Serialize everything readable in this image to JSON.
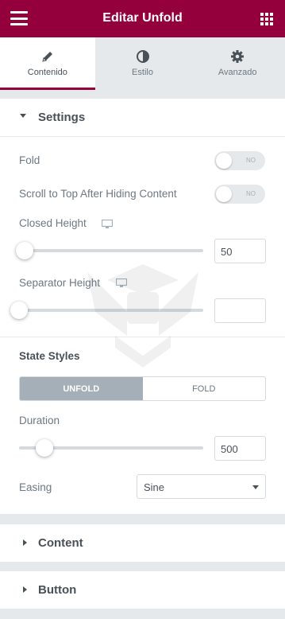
{
  "header": {
    "title": "Editar Unfold"
  },
  "tabs": [
    {
      "label": "Contenido",
      "icon": "pencil-icon"
    },
    {
      "label": "Estilo",
      "icon": "half-circle-icon"
    },
    {
      "label": "Avanzado",
      "icon": "gear-icon"
    }
  ],
  "settings": {
    "title": "Settings",
    "fold_label": "Fold",
    "fold_toggle": "NO",
    "scroll_label": "Scroll to Top After Hiding Content",
    "scroll_toggle": "NO",
    "closed_height_label": "Closed Height",
    "closed_height_value": "50",
    "closed_height_level": 0,
    "separator_height_label": "Separator Height",
    "separator_height_value": "",
    "separator_height_level": 0,
    "state_styles_label": "State Styles",
    "state_tabs": [
      "UNFOLD",
      "FOLD"
    ],
    "duration_label": "Duration",
    "duration_value": "500",
    "easing_label": "Easing",
    "easing_value": "Sine"
  },
  "sections": {
    "content_title": "Content",
    "button_title": "Button"
  },
  "colors": {
    "brand": "#93003c",
    "active_segment": "#a4afb7"
  }
}
